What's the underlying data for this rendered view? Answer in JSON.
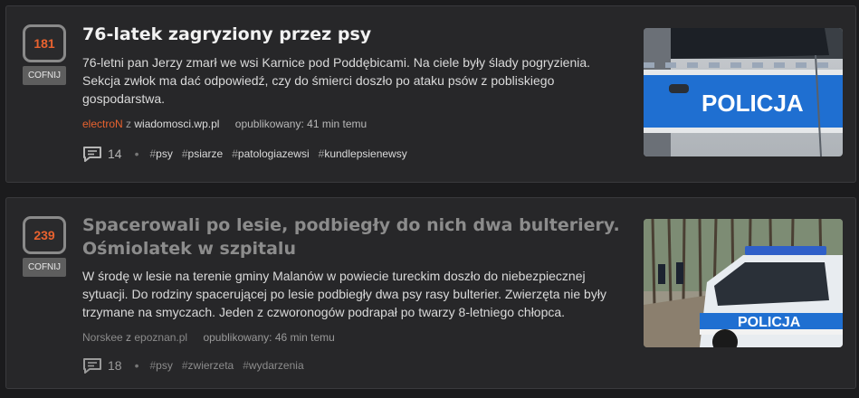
{
  "posts": [
    {
      "votes": "181",
      "vote_button": "COFNIJ",
      "title": "76-latek zagryziony przez psy",
      "description": "76-letni pan Jerzy zmarł we wsi Karnice pod Poddębicami. Na ciele były ślady pogryzienia. Sekcja zwłok ma dać odpowiedź, czy do śmierci doszło po ataku psów z pobliskiego gospodarstwa.",
      "author": "electroN",
      "source_prefix": "z",
      "source": "wiadomosci.wp.pl",
      "published": "opublikowany: 41 min temu",
      "comments": "14",
      "separator": "•",
      "tags": [
        "psy",
        "psiarze",
        "patologiazewsi",
        "kundlepsienewsy"
      ],
      "thumbnail_text": "POLICJA"
    },
    {
      "votes": "239",
      "vote_button": "COFNIJ",
      "title": "Spacerowali po lesie, podbiegły do nich dwa bulteriery. Ośmiolatek w szpitalu",
      "description": "W środę w lesie na terenie gminy Malanów w powiecie tureckim doszło do niebezpiecznej sytuacji. Do rodziny spacerującej po lesie podbiegły dwa psy rasy bulterier. Zwierzęta nie były trzymane na smyczach. Jeden z czworonogów podrapał po twarzy 8-letniego chłopca.",
      "author": "Norskee",
      "source_prefix": "z",
      "source": "epoznan.pl",
      "published": "opublikowany: 46 min temu",
      "comments": "18",
      "separator": "•",
      "tags": [
        "psy",
        "zwierzeta",
        "wydarzenia"
      ],
      "thumbnail_text": "POLICJA"
    }
  ],
  "hash_symbol": "#",
  "colors": {
    "background": "#1b1b1d",
    "card": "#272729",
    "accent": "#e8622f",
    "police_blue": "#1f6fd1"
  },
  "icons": [
    "comment-icon"
  ]
}
